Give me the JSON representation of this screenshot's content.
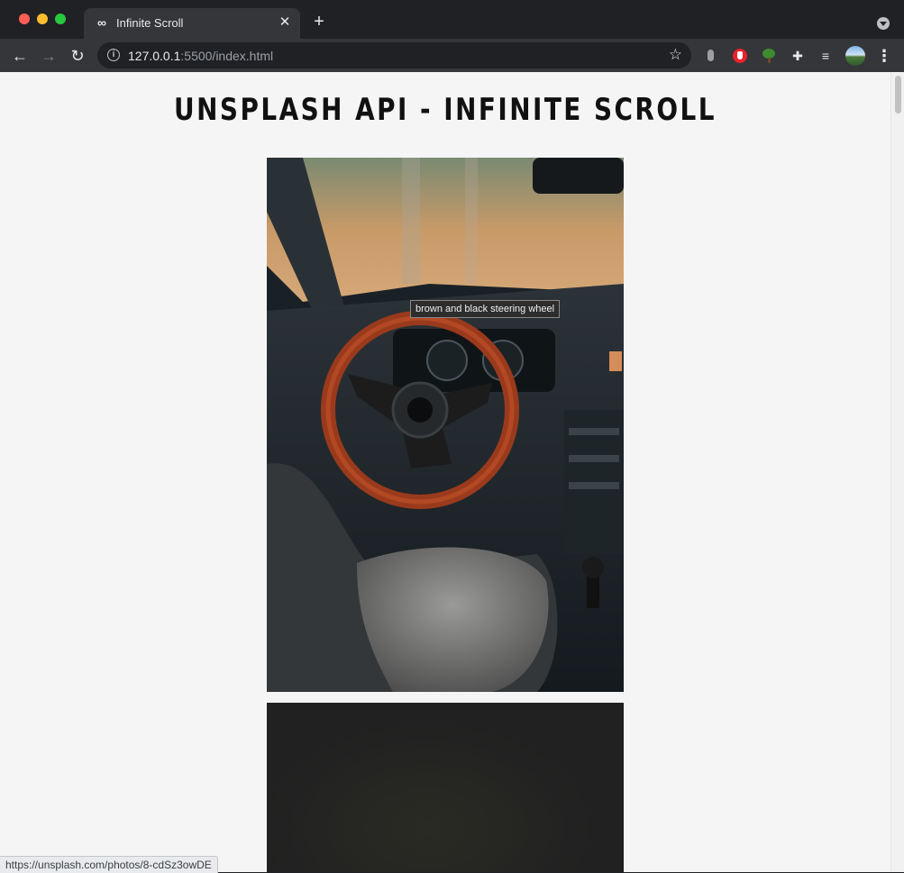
{
  "browser": {
    "tab": {
      "title": "Infinite Scroll",
      "favicon": "∞",
      "close": "✕"
    },
    "new_tab": "+",
    "nav": {
      "back": "←",
      "forward": "→",
      "reload": "↻"
    },
    "address": {
      "host": "127.0.0.1",
      "path": ":5500/index.html",
      "info": "i",
      "bookmark": "☆"
    },
    "extensions": {
      "puzzle": "✚",
      "media": "≡",
      "menu": "⋮"
    }
  },
  "page": {
    "title": "UNSPLASH API - INFINITE SCROLL",
    "photos": [
      {
        "alt": "brown and black steering wheel"
      },
      {
        "alt": ""
      }
    ],
    "tooltip": "brown and black steering wheel"
  },
  "status_bar": {
    "url": "https://unsplash.com/photos/8-cdSz3owDE"
  },
  "colors": {
    "chrome_dark": "#202124",
    "toolbar": "#35363a",
    "page_bg": "#f5f5f5",
    "title_text": "#111111"
  }
}
